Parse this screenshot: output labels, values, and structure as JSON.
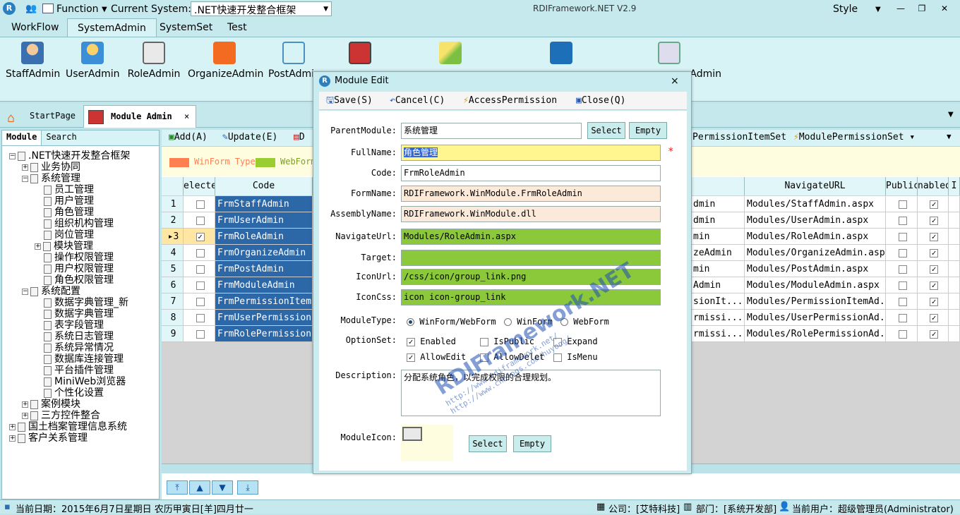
{
  "titlebar": {
    "function_label": "Function",
    "current_system_label": "Current System:",
    "current_system_value": ".NET快速开发整合框架",
    "app_title": "RDIFramework.NET V2.9",
    "style_label": "Style"
  },
  "ribbon": {
    "tabs": [
      "WorkFlow",
      "SystemAdmin",
      "SystemSet",
      "Test"
    ],
    "buttons": [
      "StaffAdmin",
      "UserAdmin",
      "RoleAdmin",
      "OrganizeAdmin",
      "PostAdmi",
      "Admin"
    ]
  },
  "doctabs": {
    "start": "StartPage",
    "module": "Module Admin",
    "close": "×"
  },
  "left": {
    "tab_module": "Module",
    "tab_search": "Search",
    "tree": [
      ".NET快速开发整合框架",
      "业务协同",
      "系统管理",
      "员工管理",
      "用户管理",
      "角色管理",
      "组织机构管理",
      "岗位管理",
      "模块管理",
      "操作权限管理",
      "用户权限管理",
      "角色权限管理",
      "系统配置",
      "数据字典管理_新",
      "数据字典管理",
      "表字段管理",
      "系统日志管理",
      "系统异常情况",
      "数据库连接管理",
      "平台插件管理",
      "MiniWeb浏览器",
      "个性化设置",
      "案例模块",
      "三方控件整合",
      "国土档案管理信息系统",
      "客户关系管理"
    ]
  },
  "toolbar": {
    "add": "Add(A)",
    "update": "Update(E)",
    "d": "D",
    "perm_item_set": "PermissionItemSet",
    "module_perm_set": "ModulePermissionSet"
  },
  "legend": {
    "winform": "WinForm Type",
    "webform": "WebForm"
  },
  "grid": {
    "headers": {
      "select": "electe",
      "code": "Code",
      "navurl": "NavigateURL",
      "public": "Public",
      "enabled": "nabled",
      "last": "I"
    },
    "rows": [
      {
        "n": "1",
        "code": "FrmStaffAdmin",
        "mid": "dmin",
        "url": "Modules/StaffAdmin.aspx",
        "sel": false
      },
      {
        "n": "2",
        "code": "FrmUserAdmin",
        "mid": "dmin",
        "url": "Modules/UserAdmin.aspx",
        "sel": false
      },
      {
        "n": "3",
        "code": "FrmRoleAdmin",
        "mid": "min",
        "url": "Modules/RoleAdmin.aspx",
        "sel": true
      },
      {
        "n": "4",
        "code": "FrmOrganizeAdmin",
        "mid": "zeAdmin",
        "url": "Modules/OrganizeAdmin.aspx",
        "sel": false
      },
      {
        "n": "5",
        "code": "FrmPostAdmin",
        "mid": "min",
        "url": "Modules/PostAdmin.aspx",
        "sel": false
      },
      {
        "n": "6",
        "code": "FrmModuleAdmin",
        "mid": "Admin",
        "url": "Modules/ModuleAdmin.aspx",
        "sel": false
      },
      {
        "n": "7",
        "code": "FrmPermissionItem..",
        "mid": "sionIt...",
        "url": "Modules/PermissionItemAd...",
        "sel": false
      },
      {
        "n": "8",
        "code": "FrmUserPermission..",
        "mid": "rmissi...",
        "url": "Modules/UserPermissionAd...",
        "sel": false
      },
      {
        "n": "9",
        "code": "FrmRolePermission..",
        "mid": "rmissi...",
        "url": "Modules/RolePermissionAd...",
        "sel": false
      }
    ]
  },
  "status": {
    "date": "当前日期：2015年6月7日星期日 农历甲寅日[羊]四月廿一",
    "company": "公司：[艾特科技]",
    "dept": "部门：[系统开发部]",
    "user": "当前用户：超级管理员(Administrator)"
  },
  "dialog": {
    "title": "Module Edit",
    "close": "×",
    "tools": {
      "save": "Save(S)",
      "cancel": "Cancel(C)",
      "access": "AccessPermission",
      "close": "Close(Q)"
    },
    "labels": {
      "parent": "ParentModule:",
      "fullname": "FullName:",
      "code": "Code:",
      "formname": "FormName:",
      "assembly": "AssemblyName:",
      "navurl": "NavigateUrl:",
      "target": "Target:",
      "iconurl": "IconUrl:",
      "iconcss": "IconCss:",
      "moduletype": "ModuleType:",
      "optionset": "OptionSet:",
      "description": "Description:",
      "moduleicon": "ModuleIcon:"
    },
    "values": {
      "parent": "系统管理",
      "fullname": "角色管理",
      "code": "FrmRoleAdmin",
      "formname": "RDIFramework.WinModule.FrmRoleAdmin",
      "assembly": "RDIFramework.WinModule.dll",
      "navurl": "Modules/RoleAdmin.aspx",
      "target": "",
      "iconurl": "/css/icon/group_link.png",
      "iconcss": "icon icon-group_link",
      "description": "分配系统角色，以完成权限的合理规划。"
    },
    "buttons": {
      "select": "Select",
      "empty": "Empty"
    },
    "required": "*",
    "moduletypes": [
      "WinForm/WebForm",
      "WinForm",
      "WebForm"
    ],
    "options": [
      {
        "label": "Enabled",
        "checked": true
      },
      {
        "label": "IsPublic",
        "checked": false
      },
      {
        "label": "Expand",
        "checked": false
      },
      {
        "label": "AllowEdit",
        "checked": true
      },
      {
        "label": "AllowDelet",
        "checked": false
      },
      {
        "label": "IsMenu",
        "checked": false
      }
    ],
    "watermark": {
      "big": "RDIFramework.NET",
      "small": "http://www.rdiframework.net/",
      "small2": "http://www.cnblogs.com/huyong/"
    }
  },
  "colors": {
    "selected_row": "#ffe7a3",
    "code_cell": "#2c67a8",
    "winform": "#ff7f50",
    "webform": "#9acd32",
    "green_input": "#8bc83a",
    "yellow_input": "#fff68f",
    "beige_input": "#fbe9d9"
  }
}
